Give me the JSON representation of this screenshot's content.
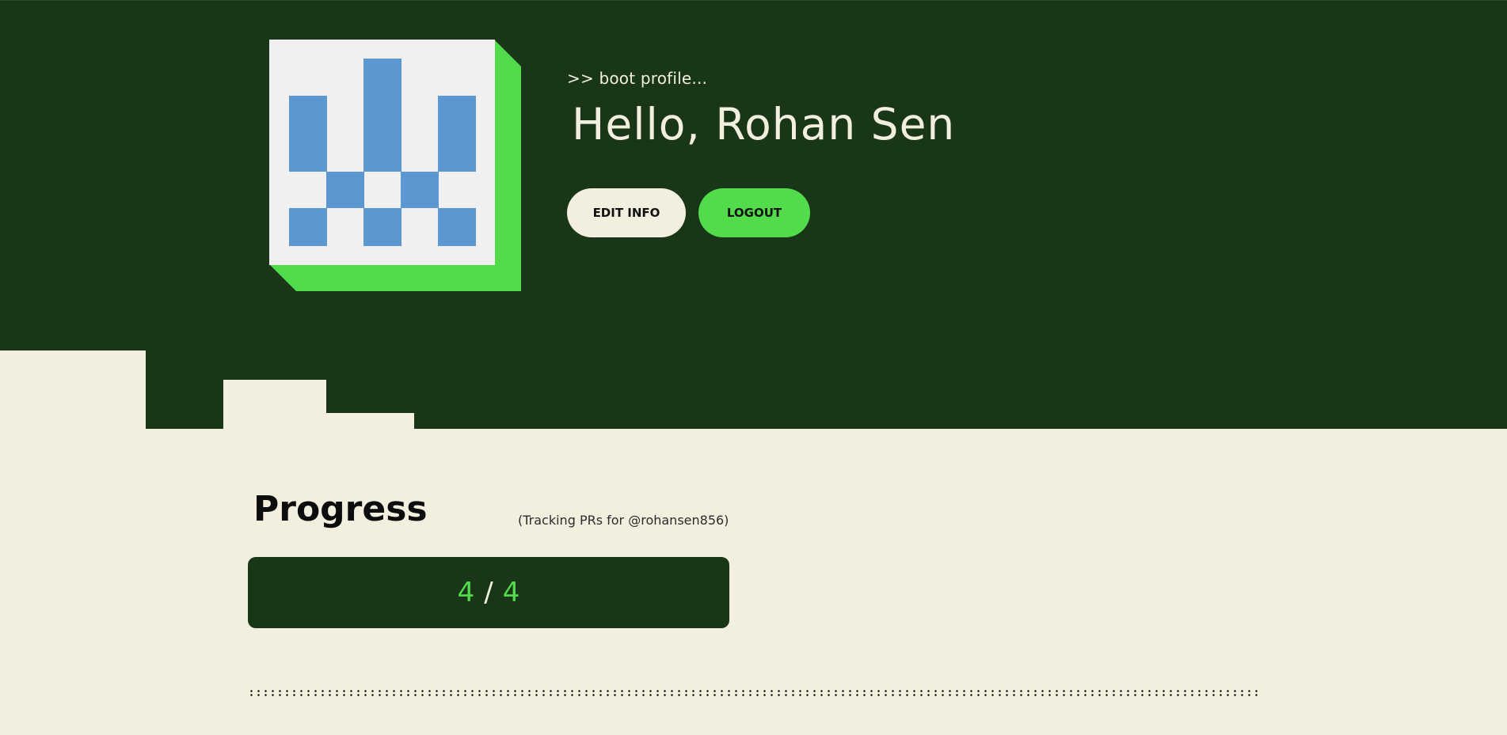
{
  "header": {
    "boot_text": ">> boot profile...",
    "greeting": "Hello, Rohan Sen",
    "edit_label": "EDIT INFO",
    "logout_label": "LOGOUT"
  },
  "avatar": {
    "description_icon": "pixel-identicon",
    "pixel_color": "#5b97d0",
    "background_color": "#f0f0f0",
    "shadow_color": "#52dc4c"
  },
  "progress": {
    "title": "Progress",
    "tracking_note": "(Tracking PRs for @rohansen856)",
    "completed": "4",
    "separator": "/",
    "total": "4"
  },
  "theme": {
    "dark_green": "#193718",
    "bright_green": "#52dc4c",
    "cream": "#f2efdf"
  }
}
